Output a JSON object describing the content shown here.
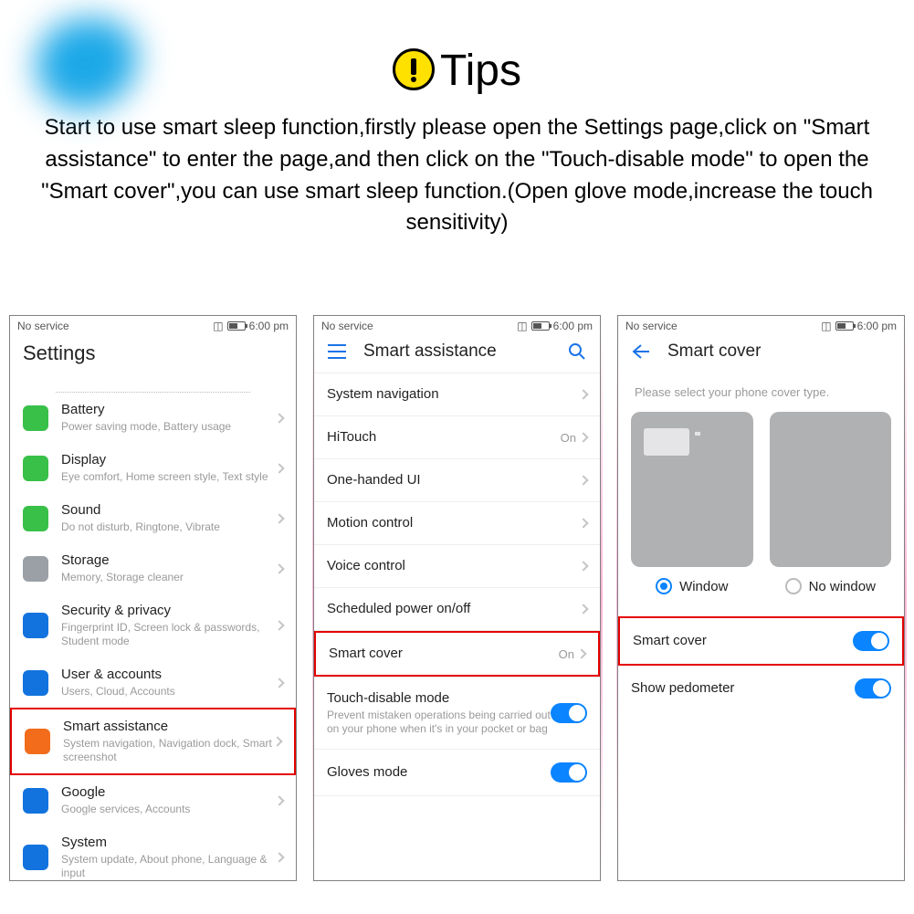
{
  "tips": {
    "title": "Tips",
    "body": "Start to use smart sleep function,firstly please open the Settings page,click on \"Smart assistance\" to enter the page,and then click on the \"Touch-disable mode\" to open the \"Smart cover\",you can use smart sleep function.(Open glove mode,increase the touch sensitivity)"
  },
  "statusbar": {
    "left": "No service",
    "time": "6:00 pm"
  },
  "screen1": {
    "title": "Settings",
    "items": [
      {
        "label": "Battery",
        "sub": "Power saving mode, Battery usage",
        "color": "#38c048"
      },
      {
        "label": "Display",
        "sub": "Eye comfort, Home screen style, Text style",
        "color": "#38c048"
      },
      {
        "label": "Sound",
        "sub": "Do not disturb, Ringtone, Vibrate",
        "color": "#38c048"
      },
      {
        "label": "Storage",
        "sub": "Memory, Storage cleaner",
        "color": "#9aa0a6"
      },
      {
        "label": "Security & privacy",
        "sub": "Fingerprint ID, Screen lock & passwords, Student mode",
        "color": "#1273de"
      },
      {
        "label": "User & accounts",
        "sub": "Users, Cloud, Accounts",
        "color": "#1273de"
      },
      {
        "label": "Smart assistance",
        "sub": "System navigation, Navigation dock, Smart screenshot",
        "color": "#f26c1c",
        "highlight": true
      },
      {
        "label": "Google",
        "sub": "Google services, Accounts",
        "color": "#1273de"
      },
      {
        "label": "System",
        "sub": "System update, About phone, Language & input",
        "color": "#1273de"
      }
    ]
  },
  "screen2": {
    "title": "Smart assistance",
    "items": [
      {
        "label": "System navigation"
      },
      {
        "label": "HiTouch",
        "value": "On"
      },
      {
        "label": "One-handed UI"
      },
      {
        "label": "Motion control"
      },
      {
        "label": "Voice control"
      },
      {
        "label": "Scheduled power on/off"
      },
      {
        "label": "Smart cover",
        "value": "On",
        "highlight": true
      },
      {
        "label": "Touch-disable mode",
        "sub": "Prevent mistaken operations being carried out on your phone when it's in your pocket or bag",
        "toggle": true
      },
      {
        "label": "Gloves mode",
        "toggle": true
      }
    ]
  },
  "screen3": {
    "title": "Smart cover",
    "hint": "Please select your phone cover type.",
    "opt_window": "Window",
    "opt_nowindow": "No window",
    "rows": [
      {
        "label": "Smart cover",
        "toggle": true,
        "highlight": true
      },
      {
        "label": "Show pedometer",
        "toggle": true
      }
    ]
  }
}
